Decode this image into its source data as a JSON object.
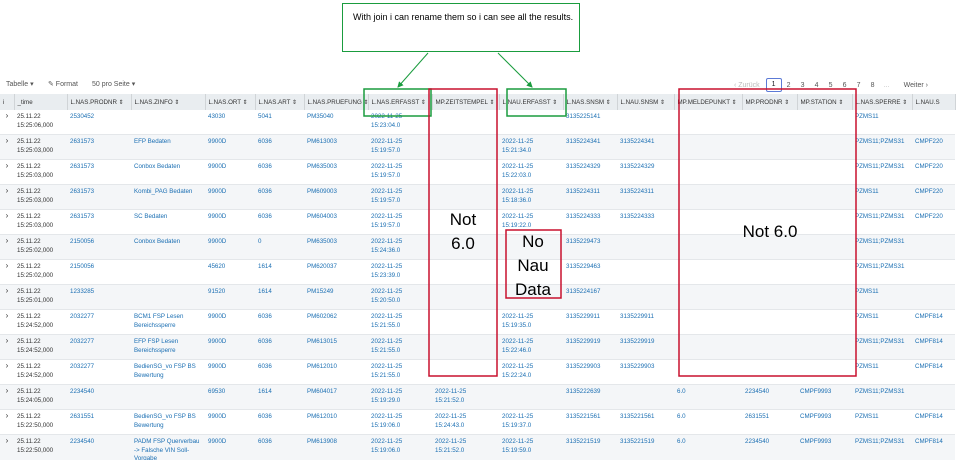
{
  "callout": {
    "text": "With join i can rename them so i can see all the results."
  },
  "toolbar": {
    "table_label": "Tabelle ▾",
    "format_label": "✎ Format",
    "per_page_label": "50 pro Seite ▾"
  },
  "pager": {
    "prev": "‹ Zurück",
    "pages": [
      "1",
      "2",
      "3",
      "4",
      "5",
      "6",
      "7",
      "8"
    ],
    "ellipsis": "...",
    "next": "Weiter ›",
    "active_page": "1"
  },
  "table": {
    "columns": [
      "i",
      "_time",
      "L.NAS.PRODNR ⇕",
      "L.NAS.ZINFO ⇕",
      "L.NAS.ORT ⇕",
      "L.NAS.ART ⇕",
      "L.NAS.PRUEFUNG ⇕",
      "L.NAS.ERFASST ⇕",
      "MP.ZEITSTEMPEL ⇕",
      "L.NAU.ERFASST ⇕",
      "L.NAS.SNSM ⇕",
      "L.NAU.SNSM ⇕",
      "MP.MELDEPUNKT ⇕",
      "MP.PRODNR ⇕",
      "MP.STATION ⇕",
      "L.NAS.SPERRE ⇕",
      "L.NAU.S"
    ],
    "rows": [
      {
        "time": "25.11.22 15:25:06,000",
        "prodnr": "2530452",
        "zinfo": "",
        "ort": "43030",
        "art": "5041",
        "pruefung": "PM35040",
        "nas_erfasst": "2022-11-25 15:23:04.0",
        "zeitstempel": "",
        "nau_erfasst": "",
        "nas_snsm": "3135225141",
        "nau_snsm": "",
        "meldepunkt": "",
        "mp_prodnr": "",
        "station": "",
        "sperre": "PZMS11",
        "nau_s": ""
      },
      {
        "time": "25.11.22 15:25:03,000",
        "prodnr": "2631573",
        "zinfo": "EFP Bedaten",
        "ort": "9900D",
        "art": "6036",
        "pruefung": "PM613003",
        "nas_erfasst": "2022-11-25 15:19:57.0",
        "zeitstempel": "",
        "nau_erfasst": "2022-11-25 15:21:34.0",
        "nas_snsm": "3135224341",
        "nau_snsm": "3135224341",
        "meldepunkt": "",
        "mp_prodnr": "",
        "station": "",
        "sperre": "PZMS11;PZMS31",
        "nau_s": "CMPF220"
      },
      {
        "time": "25.11.22 15:25:03,000",
        "prodnr": "2631573",
        "zinfo": "Conbox Bedaten",
        "ort": "9900D",
        "art": "6036",
        "pruefung": "PM635003",
        "nas_erfasst": "2022-11-25 15:19:57.0",
        "zeitstempel": "",
        "nau_erfasst": "2022-11-25 15:22:03.0",
        "nas_snsm": "3135224329",
        "nau_snsm": "3135224329",
        "meldepunkt": "",
        "mp_prodnr": "",
        "station": "",
        "sperre": "PZMS11;PZMS31",
        "nau_s": "CMPF220"
      },
      {
        "time": "25.11.22 15:25:03,000",
        "prodnr": "2631573",
        "zinfo": "Kombi_PAG Bedaten",
        "ort": "9900D",
        "art": "6036",
        "pruefung": "PM609003",
        "nas_erfasst": "2022-11-25 15:19:57.0",
        "zeitstempel": "",
        "nau_erfasst": "2022-11-25 15:18:36.0",
        "nas_snsm": "3135224311",
        "nau_snsm": "3135224311",
        "meldepunkt": "",
        "mp_prodnr": "",
        "station": "",
        "sperre": "PZMS11",
        "nau_s": "CMPF220"
      },
      {
        "time": "25.11.22 15:25:03,000",
        "prodnr": "2631573",
        "zinfo": "SC Bedaten",
        "ort": "9900D",
        "art": "6036",
        "pruefung": "PM604003",
        "nas_erfasst": "2022-11-25 15:19:57.0",
        "zeitstempel": "",
        "nau_erfasst": "2022-11-25 15:19:22.0",
        "nas_snsm": "3135224333",
        "nau_snsm": "3135224333",
        "meldepunkt": "",
        "mp_prodnr": "",
        "station": "",
        "sperre": "PZMS11;PZMS31",
        "nau_s": "CMPF220"
      },
      {
        "time": "25.11.22 15:25:02,000",
        "prodnr": "2150056",
        "zinfo": "Conbox Bedaten",
        "ort": "9900D",
        "art": "0",
        "pruefung": "PM635003",
        "nas_erfasst": "2022-11-25 15:24:36.0",
        "zeitstempel": "",
        "nau_erfasst": "",
        "nas_snsm": "3135229473",
        "nau_snsm": "",
        "meldepunkt": "",
        "mp_prodnr": "",
        "station": "",
        "sperre": "PZMS11;PZMS31",
        "nau_s": ""
      },
      {
        "time": "25.11.22 15:25:02,000",
        "prodnr": "2150056",
        "zinfo": "",
        "ort": "45620",
        "art": "1614",
        "pruefung": "PM620037",
        "nas_erfasst": "2022-11-25 15:23:39.0",
        "zeitstempel": "",
        "nau_erfasst": "",
        "nas_snsm": "3135229463",
        "nau_snsm": "",
        "meldepunkt": "",
        "mp_prodnr": "",
        "station": "",
        "sperre": "PZMS11;PZMS31",
        "nau_s": ""
      },
      {
        "time": "25.11.22 15:25:01,000",
        "prodnr": "1233285",
        "zinfo": "",
        "ort": "91520",
        "art": "1614",
        "pruefung": "PM15249",
        "nas_erfasst": "2022-11-25 15:20:50.0",
        "zeitstempel": "",
        "nau_erfasst": "",
        "nas_snsm": "3135224167",
        "nau_snsm": "",
        "meldepunkt": "",
        "mp_prodnr": "",
        "station": "",
        "sperre": "PZMS11",
        "nau_s": ""
      },
      {
        "time": "25.11.22 15:24:52,000",
        "prodnr": "2032277",
        "zinfo": "BCM1 FSP Lesen Bereichssperre",
        "ort": "9900D",
        "art": "6036",
        "pruefung": "PM602062",
        "nas_erfasst": "2022-11-25 15:21:55.0",
        "zeitstempel": "",
        "nau_erfasst": "2022-11-25 15:19:35.0",
        "nas_snsm": "3135229911",
        "nau_snsm": "3135229911",
        "meldepunkt": "",
        "mp_prodnr": "",
        "station": "",
        "sperre": "PZMS11",
        "nau_s": "CMPF814"
      },
      {
        "time": "25.11.22 15:24:52,000",
        "prodnr": "2032277",
        "zinfo": "EFP FSP Lesen Bereichssperre",
        "ort": "9900D",
        "art": "6036",
        "pruefung": "PM613015",
        "nas_erfasst": "2022-11-25 15:21:55.0",
        "zeitstempel": "",
        "nau_erfasst": "2022-11-25 15:22:46.0",
        "nas_snsm": "3135229919",
        "nau_snsm": "3135229919",
        "meldepunkt": "",
        "mp_prodnr": "",
        "station": "",
        "sperre": "PZMS11;PZMS31",
        "nau_s": "CMPF814"
      },
      {
        "time": "25.11.22 15:24:52,000",
        "prodnr": "2032277",
        "zinfo": "BedienSG_vo FSP BS Bewertung",
        "ort": "9900D",
        "art": "6036",
        "pruefung": "PM612010",
        "nas_erfasst": "2022-11-25 15:21:55.0",
        "zeitstempel": "",
        "nau_erfasst": "2022-11-25 15:22:24.0",
        "nas_snsm": "3135229903",
        "nau_snsm": "3135229903",
        "meldepunkt": "",
        "mp_prodnr": "",
        "station": "",
        "sperre": "PZMS11",
        "nau_s": "CMPF814"
      },
      {
        "time": "25.11.22 15:24:05,000",
        "prodnr": "2234540",
        "zinfo": "",
        "ort": "69530",
        "art": "1614",
        "pruefung": "PM604017",
        "nas_erfasst": "2022-11-25 15:19:29.0",
        "zeitstempel": "2022-11-25 15:21:52.0",
        "nau_erfasst": "",
        "nas_snsm": "3135222639",
        "nau_snsm": "",
        "meldepunkt": "6.0",
        "mp_prodnr": "2234540",
        "station": "CMPF9993",
        "sperre": "PZMS11;PZMS31",
        "nau_s": ""
      },
      {
        "time": "25.11.22 15:22:50,000",
        "prodnr": "2631551",
        "zinfo": "BedienSG_vo FSP BS Bewertung",
        "ort": "9900D",
        "art": "6036",
        "pruefung": "PM612010",
        "nas_erfasst": "2022-11-25 15:19:06.0",
        "zeitstempel": "2022-11-25 15:24:43.0",
        "nau_erfasst": "2022-11-25 15:19:37.0",
        "nas_snsm": "3135221561",
        "nau_snsm": "3135221561",
        "meldepunkt": "6.0",
        "mp_prodnr": "2631551",
        "station": "CMPF9993",
        "sperre": "PZMS11",
        "nau_s": "CMPF814"
      },
      {
        "time": "25.11.22 15:22:50,000",
        "prodnr": "2234540",
        "zinfo": "PADM FSP Querverbau -> Falsche VIN Soll-Vorgabe",
        "ort": "9900D",
        "art": "6036",
        "pruefung": "PM613908",
        "nas_erfasst": "2022-11-25 15:19:06.0",
        "zeitstempel": "2022-11-25 15:21:52.0",
        "nau_erfasst": "2022-11-25 15:19:59.0",
        "nas_snsm": "3135221519",
        "nau_snsm": "3135221519",
        "meldepunkt": "6.0",
        "mp_prodnr": "2234540",
        "station": "CMPF9993",
        "sperre": "PZMS11;PZMS31",
        "nau_s": "CMPF814"
      }
    ]
  },
  "annotations": {
    "not60_left": "Not 6.0",
    "no_nau": "No Nau Data",
    "not60_right": "Not 6.0"
  },
  "colors": {
    "callout_border": "#1a9c3e",
    "highlight_green": "#1a9c3e",
    "highlight_red": "#c8102e",
    "link": "#1b6fb3"
  }
}
